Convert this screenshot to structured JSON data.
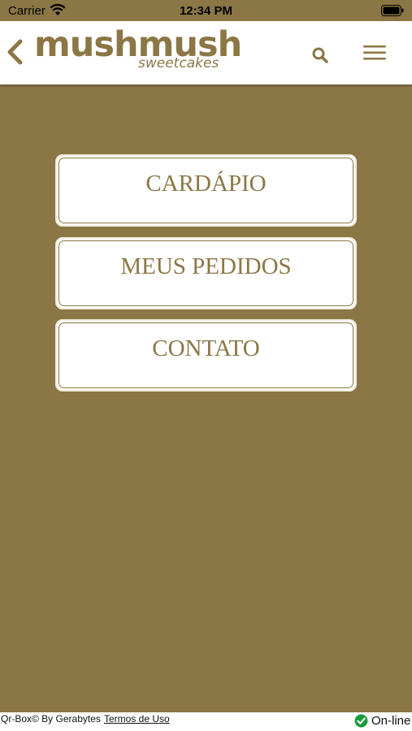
{
  "status_bar": {
    "carrier": "Carrier",
    "time": "12:34 PM",
    "icons": [
      "wifi-icon",
      "battery-icon"
    ]
  },
  "header": {
    "logo_main": "mushmush",
    "logo_sub": "sweetcakes",
    "icons": [
      "chevron-left-icon",
      "search-icon",
      "hamburger-menu-icon"
    ]
  },
  "menu": {
    "items": [
      {
        "label": "CARDÁPIO"
      },
      {
        "label": "MEUS PEDIDOS"
      },
      {
        "label": "CONTATO"
      }
    ]
  },
  "footer": {
    "copyright": "Qr-Box© By Gerabytes",
    "terms_link": "Termos de Uso",
    "status": "On-line"
  },
  "colors": {
    "background": "#8b7745",
    "accent": "#8b7745",
    "surface": "#ffffff",
    "online": "#1a9b3a"
  }
}
